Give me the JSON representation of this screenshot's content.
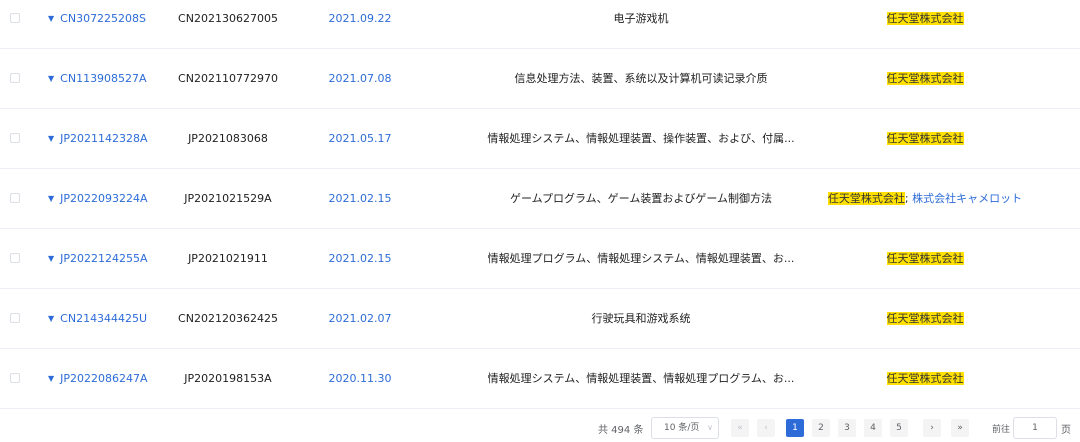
{
  "rows": [
    {
      "pub": "CN307225208S",
      "app": "CN202130627005",
      "date": "2021.09.22",
      "title": "电子游戏机",
      "applicants": [
        "任天堂株式会社"
      ]
    },
    {
      "pub": "CN113908527A",
      "app": "CN202110772970",
      "date": "2021.07.08",
      "title": "信息处理方法、装置、系统以及计算机可读记录介质",
      "applicants": [
        "任天堂株式会社"
      ]
    },
    {
      "pub": "JP2021142328A",
      "app": "JP2021083068",
      "date": "2021.05.17",
      "title": "情報処理システム、情報処理装置、操作装置、および、付属...",
      "applicants": [
        "任天堂株式会社"
      ]
    },
    {
      "pub": "JP2022093224A",
      "app": "JP2021021529A",
      "date": "2021.02.15",
      "title": "ゲームプログラム、ゲーム装置およびゲーム制御方法",
      "applicants": [
        "任天堂株式会社",
        "株式会社キャメロット"
      ]
    },
    {
      "pub": "JP2022124255A",
      "app": "JP2021021911",
      "date": "2021.02.15",
      "title": "情報処理プログラム、情報処理システム、情報処理装置、お...",
      "applicants": [
        "任天堂株式会社"
      ]
    },
    {
      "pub": "CN214344425U",
      "app": "CN202120362425",
      "date": "2021.02.07",
      "title": "行驶玩具和游戏系统",
      "applicants": [
        "任天堂株式会社"
      ]
    },
    {
      "pub": "JP2022086247A",
      "app": "JP2020198153A",
      "date": "2020.11.30",
      "title": "情報処理システム、情報処理装置、情報処理プログラム、お...",
      "applicants": [
        "任天堂株式会社"
      ]
    }
  ],
  "pagination": {
    "total_text": "共 494 条",
    "page_size": "10 条/页",
    "first_icon": "«",
    "prev_icon": "‹",
    "pages": [
      "1",
      "2",
      "3",
      "4",
      "5"
    ],
    "next_icon": "›",
    "last_icon": "»",
    "current_page": "1",
    "goto_label": "前往",
    "goto_value": "1",
    "page_unit": "页"
  },
  "colors": {
    "link": "#2d6cd8",
    "highlight": "#ffe000",
    "active_page": "#2d6cd8"
  },
  "icons": {
    "row_toggle": "caret-down-icon",
    "page_size": "chevron-down-icon"
  }
}
